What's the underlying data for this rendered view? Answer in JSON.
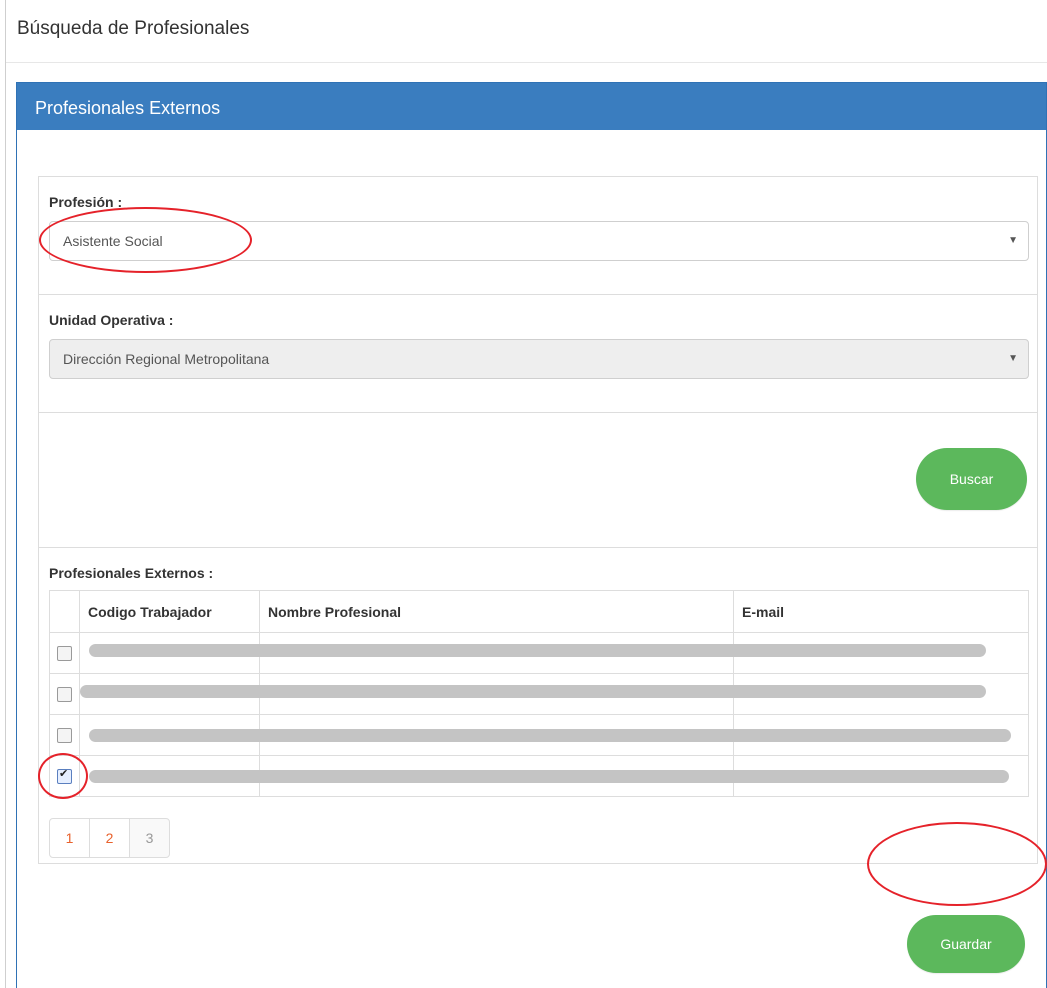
{
  "page": {
    "title": "Búsqueda de Profesionales"
  },
  "panel": {
    "title": "Profesionales Externos"
  },
  "filters": {
    "profesion": {
      "label": "Profesión :",
      "value": "Asistente Social"
    },
    "unidad": {
      "label": "Unidad Operativa :",
      "value": "Dirección Regional Metropolitana"
    }
  },
  "buttons": {
    "buscar": "Buscar",
    "guardar": "Guardar"
  },
  "table": {
    "label": "Profesionales Externos :",
    "columns": [
      "Codigo Trabajador",
      "Nombre Profesional",
      "E-mail"
    ],
    "rows": [
      {
        "checked": false
      },
      {
        "checked": false
      },
      {
        "checked": false
      },
      {
        "checked": true
      }
    ]
  },
  "pagination": {
    "pages": [
      "1",
      "2",
      "3"
    ]
  },
  "colors": {
    "primary": "#3a7dbf",
    "success": "#5cb85c",
    "annotation": "#e5222a",
    "page_link": "#e8612c"
  }
}
